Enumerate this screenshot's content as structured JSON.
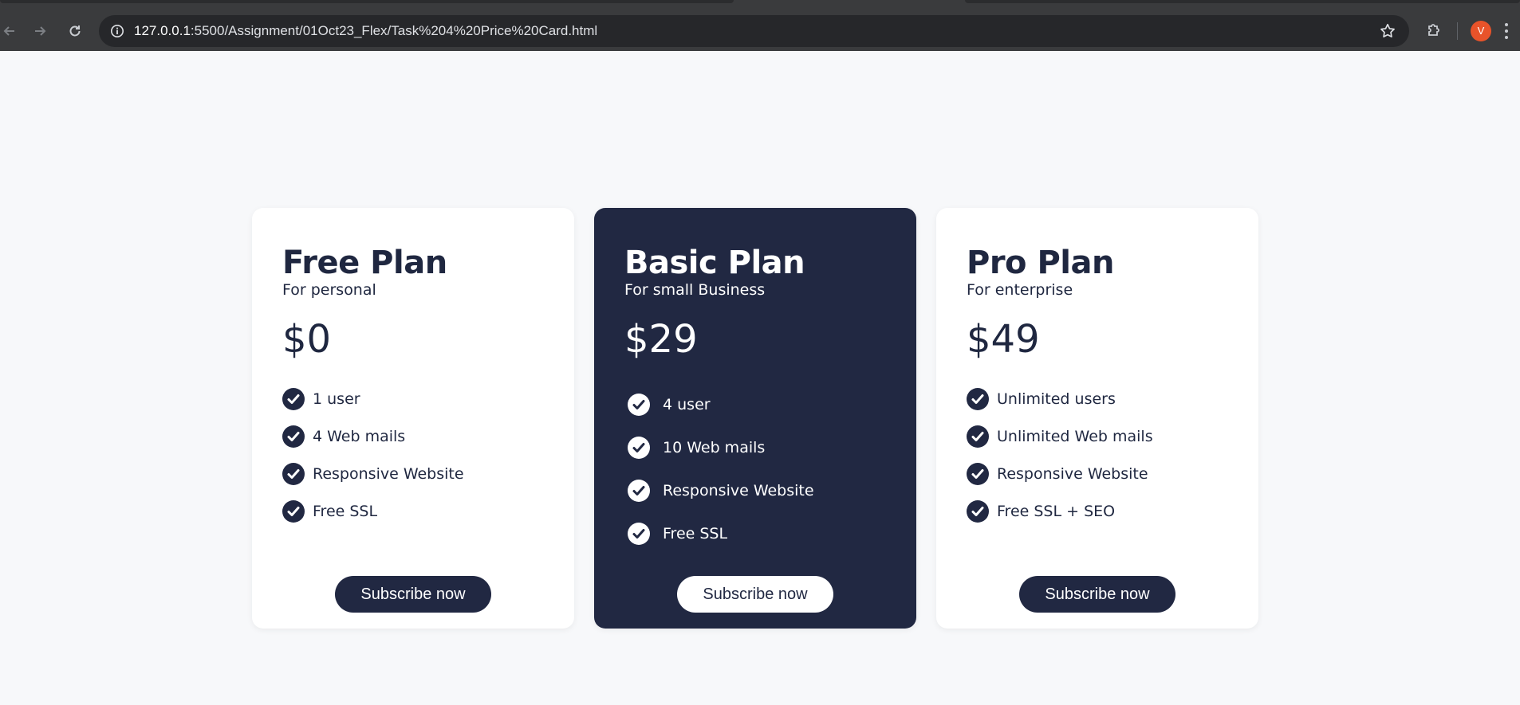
{
  "browser": {
    "url_host": "127.0.0.1",
    "url_rest": ":5500/Assignment/01Oct23_Flex/Task%204%20Price%20Card.html",
    "profile_initial": "V",
    "profile_color": "#e8532a"
  },
  "colors": {
    "dark": "#212842",
    "page_bg": "#f7f8fa"
  },
  "plans": [
    {
      "name": "Free Plan",
      "subtitle": "For personal",
      "price": "$0",
      "features": [
        "1 user",
        "4 Web mails",
        "Responsive Website",
        "Free SSL"
      ],
      "button": "Subscribe now"
    },
    {
      "name": "Basic Plan",
      "subtitle": "For small Business",
      "price": "$29",
      "features": [
        "4 user",
        "10 Web mails",
        "Responsive Website",
        "Free SSL"
      ],
      "button": "Subscribe now"
    },
    {
      "name": "Pro Plan",
      "subtitle": "For enterprise",
      "price": "$49",
      "features": [
        "Unlimited users",
        "Unlimited Web mails",
        "Responsive Website",
        "Free SSL + SEO"
      ],
      "button": "Subscribe now"
    }
  ]
}
